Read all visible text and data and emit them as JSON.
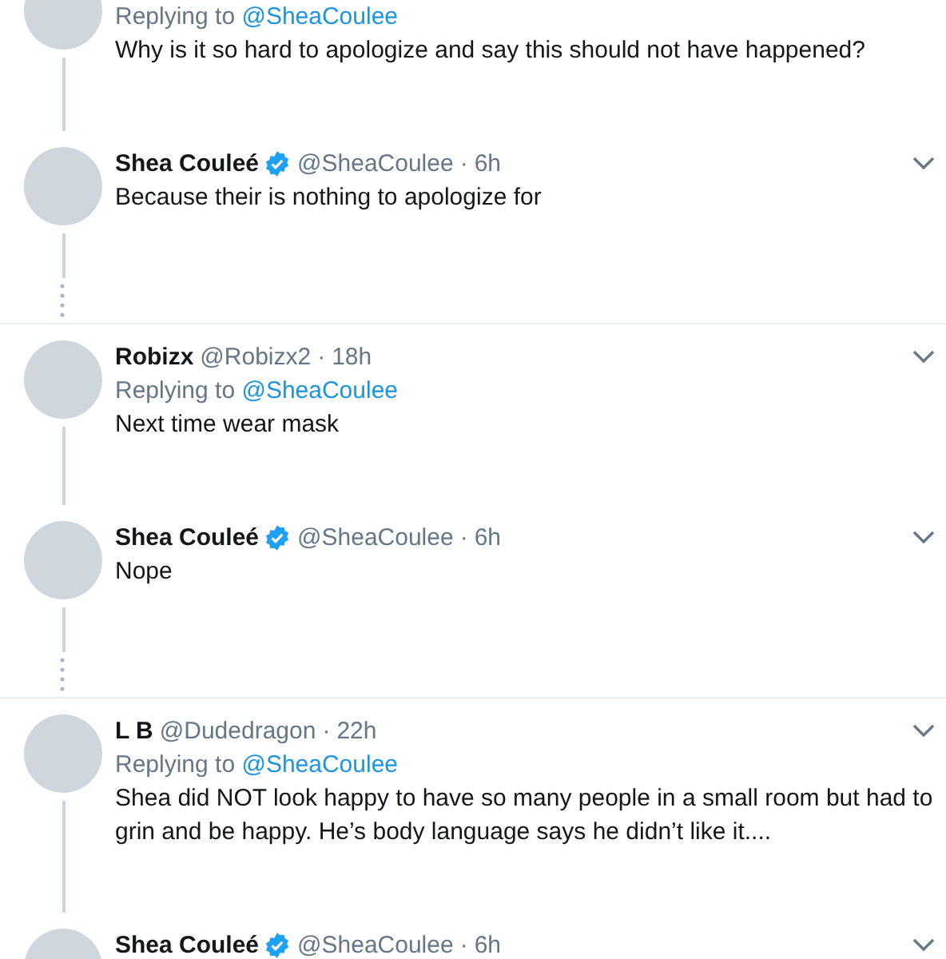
{
  "meta_separator": "·",
  "threads": [
    {
      "more_replies": true,
      "tweets": [
        {
          "reply_label": "Replying to",
          "reply_to": "@SheaCoulee",
          "text": "Why is it so hard to apologize and say this should not have happened?"
        },
        {
          "name": "Shea Couleé",
          "verified": true,
          "handle": "@SheaCoulee",
          "time": "6h",
          "text": "Because their is nothing to apologize for"
        }
      ]
    },
    {
      "more_replies": true,
      "tweets": [
        {
          "name": "Robizx",
          "verified": false,
          "handle": "@Robizx2",
          "time": "18h",
          "reply_label": "Replying to",
          "reply_to": "@SheaCoulee",
          "text": "Next time wear mask"
        },
        {
          "name": "Shea Couleé",
          "verified": true,
          "handle": "@SheaCoulee",
          "time": "6h",
          "text": "Nope"
        }
      ]
    },
    {
      "more_replies": false,
      "tweets": [
        {
          "name": "L B",
          "verified": false,
          "handle": "@Dudedragon",
          "time": "22h",
          "reply_label": "Replying to",
          "reply_to": "@SheaCoulee",
          "text": "Shea did NOT look happy to have so many people in a small room but had to grin and be happy. He’s body language says he didn’t like it...."
        },
        {
          "name": "Shea Couleé",
          "verified": true,
          "handle": "@SheaCoulee",
          "time": "6h"
        }
      ]
    }
  ]
}
